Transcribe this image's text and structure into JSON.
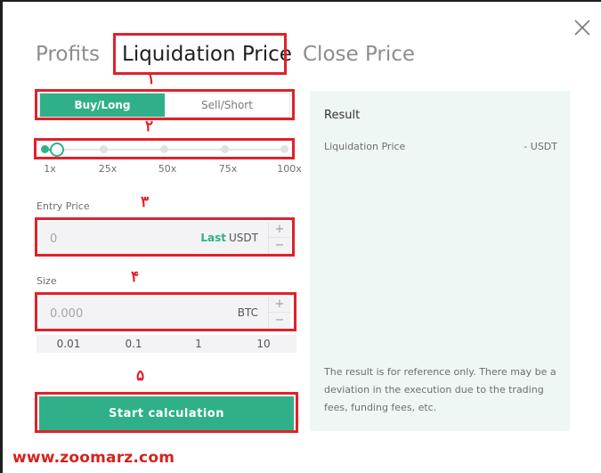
{
  "tabs": [
    {
      "label": "Profits",
      "active": false
    },
    {
      "label": "Liquidation Price",
      "active": true
    },
    {
      "label": "Close Price",
      "active": false
    }
  ],
  "direction": {
    "buy_label": "Buy/Long",
    "sell_label": "Sell/Short",
    "selected": "buy"
  },
  "leverage": {
    "ticks": [
      "1x",
      "25x",
      "50x",
      "75x",
      "100x"
    ],
    "value": 1
  },
  "entry_price": {
    "label": "Entry Price",
    "placeholder": "0",
    "last_label": "Last",
    "unit": "USDT"
  },
  "size": {
    "label": "Size",
    "placeholder": "0.000",
    "unit": "BTC"
  },
  "quick_sizes": [
    "0.01",
    "0.1",
    "1",
    "10"
  ],
  "start_button": "Start calculation",
  "result": {
    "title": "Result",
    "row_label": "Liquidation Price",
    "row_value": "- USDT",
    "note": "The result is for reference only. There may be a deviation in the execution due to the trading fees, funding fees, etc."
  },
  "markers": [
    "١",
    "٢",
    "٣",
    "۴",
    "۵"
  ],
  "watermark": "www.zoomarz.com",
  "icons": {
    "close": "close-icon",
    "plus": "plus-icon",
    "minus": "minus-icon"
  },
  "colors": {
    "accent": "#2fb089",
    "annotation": "#e0212b",
    "result_bg": "#eef7f4"
  }
}
